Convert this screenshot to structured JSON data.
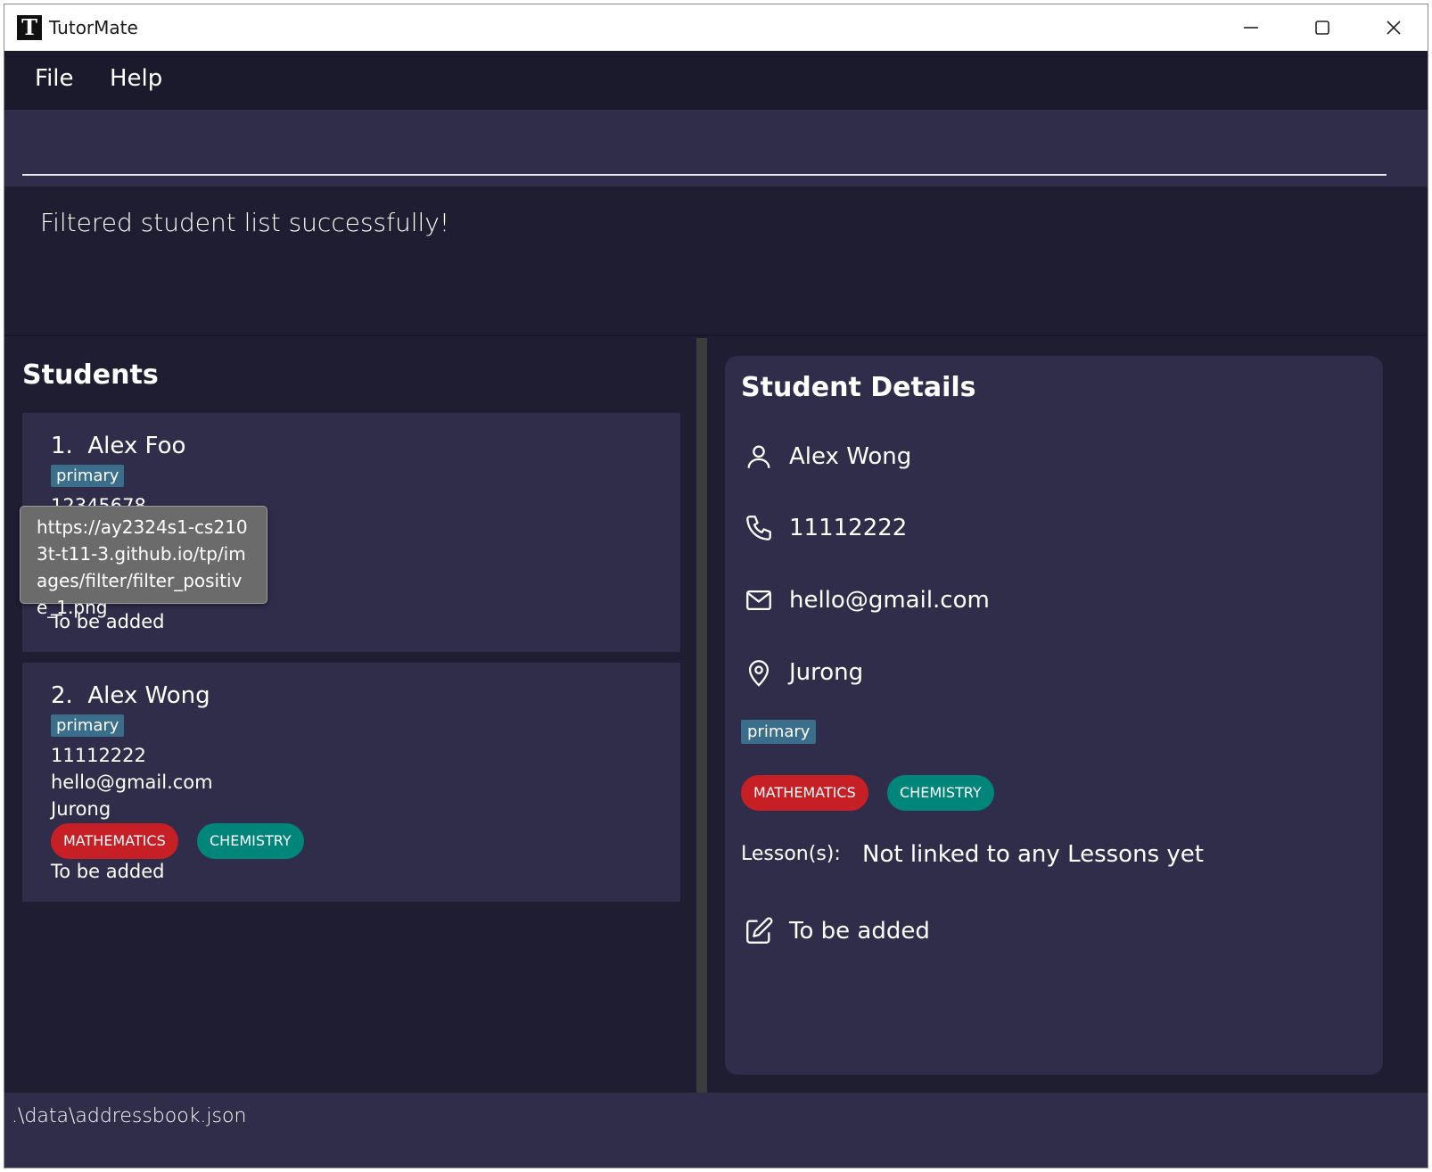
{
  "window": {
    "title": "TutorMate",
    "logo_letter": "T",
    "controls": [
      "minimize-icon",
      "maximize-icon",
      "close-icon"
    ]
  },
  "menu": {
    "file": "File",
    "help": "Help"
  },
  "command": {
    "value": "",
    "placeholder": ""
  },
  "result": {
    "message": "Filtered student list successfully!"
  },
  "students": {
    "heading": "Students",
    "items": [
      {
        "index": "1.",
        "name": "Alex Foo",
        "tag": "primary",
        "phone": "12345678",
        "remark": "To be added"
      },
      {
        "index": "2.",
        "name": "Alex Wong",
        "tag": "primary",
        "phone": "11112222",
        "email": "hello@gmail.com",
        "address": "Jurong",
        "subjects": [
          "MATHEMATICS",
          "CHEMISTRY"
        ],
        "remark": "To be added"
      }
    ]
  },
  "details": {
    "heading": "Student Details",
    "name": "Alex Wong",
    "phone": "11112222",
    "email": "hello@gmail.com",
    "address": "Jurong",
    "tag": "primary",
    "subjects": [
      "MATHEMATICS",
      "CHEMISTRY"
    ],
    "lessons_label": "Lesson(s):",
    "lessons_value": "Not linked to any Lessons yet",
    "remark": "To be added"
  },
  "tooltip": {
    "text": "https://ay2324s1-cs2103t-t11-3.github.io/tp/images/filter/filter_positive_1.png"
  },
  "status": {
    "path": ".\\data\\addressbook.json"
  },
  "colors": {
    "background": "#1e1d31",
    "panel": "#302d4a",
    "tag": "#3b6e8a",
    "mathematics": "#c62026",
    "chemistry": "#00857a"
  }
}
